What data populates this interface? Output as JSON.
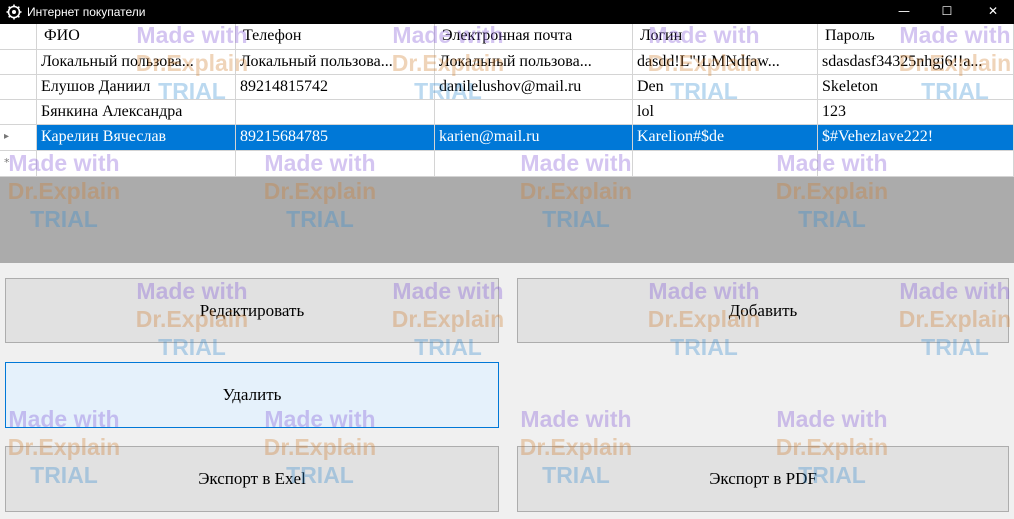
{
  "window": {
    "title": "Интернет покупатели",
    "minimize_glyph": "—",
    "maximize_glyph": "☐",
    "close_glyph": "✕",
    "icon": "app-gear-icon"
  },
  "grid": {
    "columns": [
      "ФИО",
      "Телефон",
      "Электронная почта",
      "Логин",
      "Пароль"
    ],
    "rows": [
      [
        "Локальный пользова...",
        "Локальный пользова...",
        "Локальный пользова...",
        "dasdd!L\"!LMNdfaw...",
        "sdasdasf34325nhgj6!!a..."
      ],
      [
        "Елушов Даниил",
        "89214815742",
        "danilelushov@mail.ru",
        "Den",
        "Skeleton"
      ],
      [
        "Бянкина Александра",
        "",
        "",
        "lol",
        "123"
      ],
      [
        "Карелин Вячеслав",
        "89215684785",
        "karien@mail.ru",
        "Karelion#$de",
        "$#Vehezlave222!"
      ]
    ],
    "current_row_marker": "▸",
    "new_row_marker": "*",
    "selected_row_index": 3
  },
  "buttons": {
    "edit": "Редактировать",
    "add": "Добавить",
    "delete": "Удалить",
    "export_excel": "Экспорт в Exel",
    "export_pdf": "Экспорт в PDF"
  },
  "watermark": {
    "line1": "Made with",
    "line2": "Dr.Explain",
    "line3": "TRIAL"
  }
}
